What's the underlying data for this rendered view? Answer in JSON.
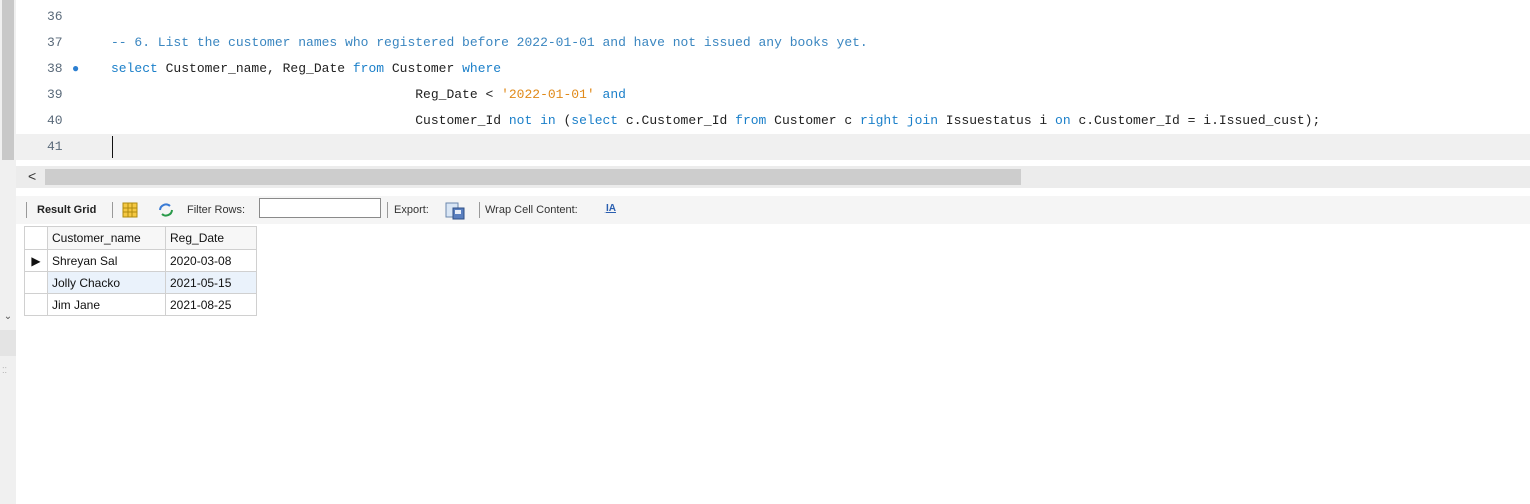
{
  "editor": {
    "lines": [
      {
        "num": "36",
        "tokens": []
      },
      {
        "num": "37",
        "tokens": [
          {
            "t": "cm",
            "s": "-- 6. List the customer names who registered before 2022-01-01 and have not issued any books yet."
          }
        ]
      },
      {
        "num": "38",
        "bullet": "●",
        "tokens": [
          {
            "t": "kw",
            "s": "select"
          },
          {
            "t": "tx",
            "s": " Customer_name, Reg_Date "
          },
          {
            "t": "kw",
            "s": "from"
          },
          {
            "t": "tx",
            "s": " Customer "
          },
          {
            "t": "kw",
            "s": "where"
          }
        ]
      },
      {
        "num": "39",
        "tokens": [
          {
            "t": "tx",
            "s": "                                       Reg_Date < "
          },
          {
            "t": "str",
            "s": "'2022-01-01'"
          },
          {
            "t": "tx",
            "s": " "
          },
          {
            "t": "kw",
            "s": "and"
          }
        ]
      },
      {
        "num": "40",
        "tokens": [
          {
            "t": "tx",
            "s": "                                       Customer_Id "
          },
          {
            "t": "kw",
            "s": "not in"
          },
          {
            "t": "tx",
            "s": " ("
          },
          {
            "t": "kw",
            "s": "select"
          },
          {
            "t": "tx",
            "s": " c.Customer_Id "
          },
          {
            "t": "kw",
            "s": "from"
          },
          {
            "t": "tx",
            "s": " Customer c "
          },
          {
            "t": "kw",
            "s": "right join"
          },
          {
            "t": "tx",
            "s": " Issuestatus i "
          },
          {
            "t": "kw",
            "s": "on"
          },
          {
            "t": "tx",
            "s": " c.Customer_Id = i.Issued_cust);"
          }
        ]
      },
      {
        "num": "41",
        "current": true,
        "tokens": []
      }
    ]
  },
  "scrollbar": {
    "left_arrow": "<"
  },
  "toolbar": {
    "result_grid": "Result Grid",
    "filter_rows": "Filter Rows:",
    "filter_value": "",
    "export": "Export:",
    "wrap": "Wrap Cell Content:"
  },
  "icons": {
    "grid": "grid-icon",
    "refresh": "refresh-icon",
    "export": "export-icon",
    "wrap": "wrap-icon"
  },
  "grid": {
    "columns": [
      "Customer_name",
      "Reg_Date"
    ],
    "rows": [
      {
        "Customer_name": "Shreyan Sal",
        "Reg_Date": "2020-03-08",
        "selected": true
      },
      {
        "Customer_name": "Jolly Chacko",
        "Reg_Date": "2021-05-15"
      },
      {
        "Customer_name": "Jim Jane",
        "Reg_Date": "2021-08-25"
      }
    ],
    "row_marker": "▶"
  }
}
